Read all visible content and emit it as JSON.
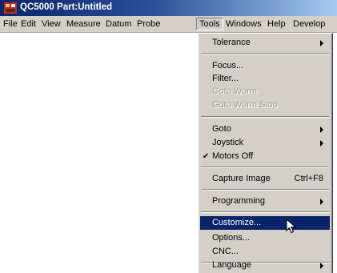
{
  "window": {
    "title": "QC5000 Part:Untitled"
  },
  "menubar": {
    "items": [
      "File",
      "Edit",
      "View",
      "Measure",
      "Datum",
      "Probe",
      "Tools",
      "Windows",
      "Help",
      "Develop"
    ],
    "open_menu": "Tools"
  },
  "tools_menu": {
    "tolerance": "Tolerance",
    "focus": "Focus...",
    "filter": "Filter...",
    "goto_worm": "Goto Worm",
    "goto_worm_stop": "Goto Worm Stop",
    "goto": "Goto",
    "joystick": "Joystick",
    "motors_off": "Motors Off",
    "motors_off_checked": true,
    "capture_image": "Capture Image",
    "capture_image_shortcut": "Ctrl+F8",
    "programming": "Programming",
    "customize": "Customize...",
    "options": "Options...",
    "cnc": "CNC...",
    "language": "Language",
    "highlighted_item": "Customize..."
  },
  "colors": {
    "titlebar": "#0a246a",
    "menu_face": "#d4d0c8",
    "highlight": "#0a246a",
    "disabled_text": "#a09d96"
  },
  "icons": {
    "app": "app-icon",
    "checkmark": "checkmark-icon",
    "submenu": "submenu-arrow-icon",
    "cursor": "arrow-cursor-icon"
  }
}
